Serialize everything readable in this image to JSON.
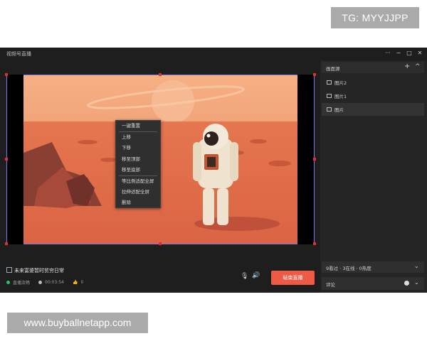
{
  "watermarks": {
    "top": "TG: MYYJJPP",
    "bottom": "www.buyballnetapp.com"
  },
  "window": {
    "title": "视频号直播",
    "controls": {
      "more": "···",
      "minimize": "−",
      "maximize": "□",
      "close": "✕"
    }
  },
  "context_menu": {
    "items": [
      "一键重置",
      "上移",
      "下移",
      "移至顶部",
      "移至底部",
      "等比例适配全屏",
      "拉伸适配全屏",
      "删除"
    ]
  },
  "sources_panel": {
    "title": "画面源",
    "add": "+",
    "collapse": "^",
    "items": [
      {
        "label": "图片2",
        "selected": false
      },
      {
        "label": "图片1",
        "selected": false
      },
      {
        "label": "图片",
        "selected": true
      }
    ]
  },
  "live": {
    "title": "未来富婆暂时贫穷日常",
    "status": "直播流畅",
    "duration": "00:03:54",
    "likes": "0",
    "end_button": "结束直播"
  },
  "stats": {
    "text": "9看过 · 3在线 · 0热度",
    "chevron": "⌄"
  },
  "comments": {
    "label": "评论",
    "chevron": "⌄"
  },
  "colors": {
    "accent": "#ef5a45",
    "selection": "#7a78e8",
    "handle": "#e3302f",
    "status_ok": "#27c36b"
  }
}
